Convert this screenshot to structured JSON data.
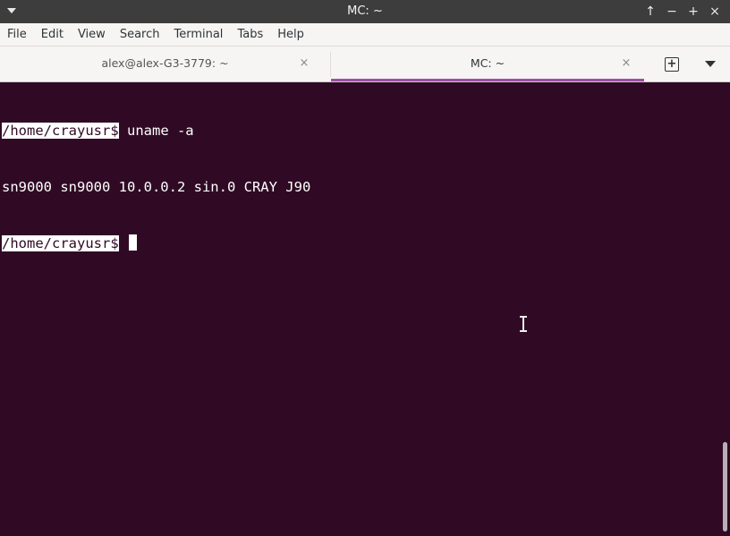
{
  "window": {
    "title": "MC: ~",
    "buttons": {
      "above": "↑",
      "minimize": "−",
      "maximize": "+",
      "close": "×"
    }
  },
  "menubar": {
    "items": [
      "File",
      "Edit",
      "View",
      "Search",
      "Terminal",
      "Tabs",
      "Help"
    ]
  },
  "tabs": [
    {
      "label": "alex@alex-G3-3779: ~",
      "active": false,
      "close": "×"
    },
    {
      "label": "MC: ~",
      "active": true,
      "close": "×"
    }
  ],
  "terminal": {
    "lines": [
      {
        "prompt": "/home/crayusr$",
        "text": " uname -a"
      },
      {
        "prompt": "",
        "text": "sn9000 sn9000 10.0.0.2 sin.0 CRAY J90"
      },
      {
        "prompt": "/home/crayusr$",
        "text": " "
      }
    ],
    "colors": {
      "background": "#300a24",
      "foreground": "#ffffff",
      "accent": "#9b50a3"
    }
  }
}
